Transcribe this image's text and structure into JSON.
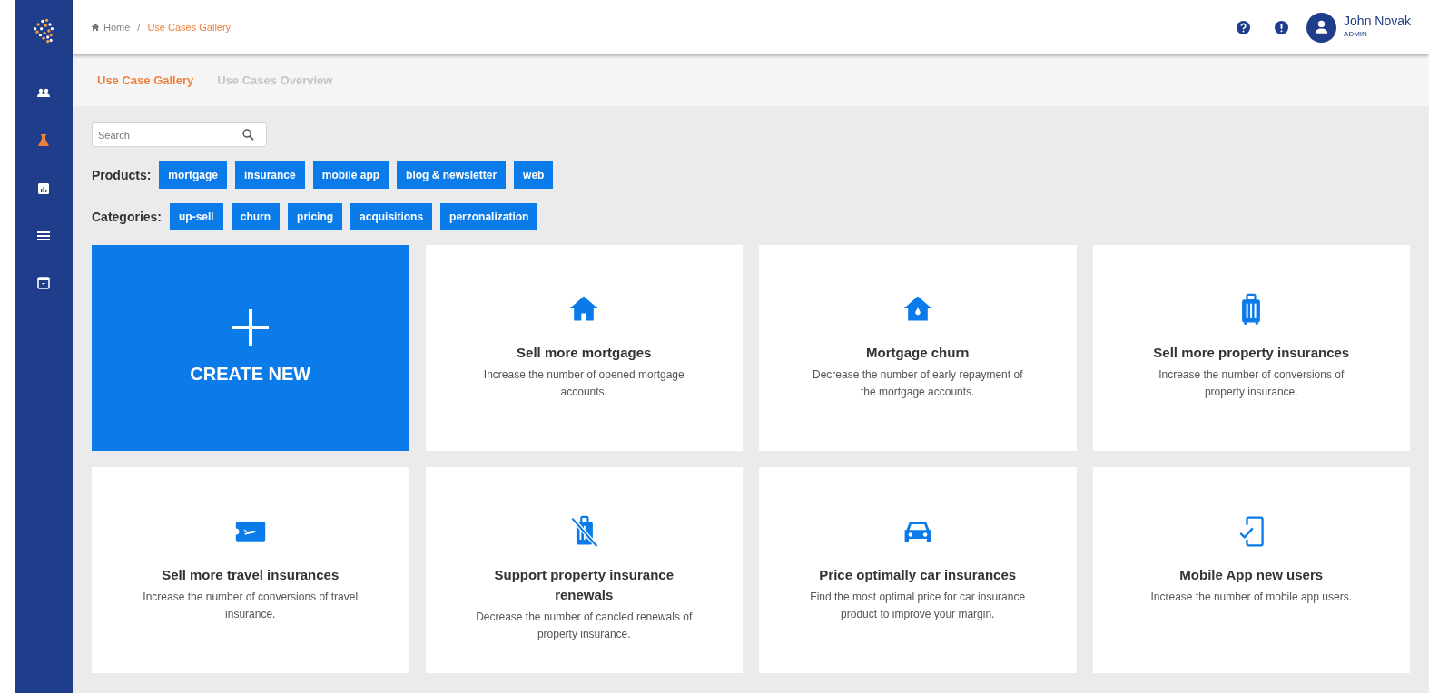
{
  "sidebar": {
    "items": [
      {
        "selected": false
      },
      {
        "selected": true
      },
      {
        "selected": false
      },
      {
        "selected": false
      },
      {
        "selected": false
      }
    ]
  },
  "breadcrumb": {
    "home": "Home",
    "separator": "/",
    "current": "Use Cases Gallery"
  },
  "user": {
    "name": "John Novak",
    "role": "ADMIN"
  },
  "tabs": [
    {
      "label": "Use Case Gallery",
      "selected": true
    },
    {
      "label": "Use Cases Overview",
      "selected": false
    }
  ],
  "search": {
    "placeholder": "Search"
  },
  "filters": [
    {
      "label": "Products:",
      "tags": [
        "mortgage",
        "insurance",
        "mobile app",
        "blog & newsletter",
        "web"
      ]
    },
    {
      "label": "Categories:",
      "tags": [
        "up-sell",
        "churn",
        "pricing",
        "acquisitions",
        "perzonalization"
      ]
    }
  ],
  "cards": [
    {
      "kind": "create",
      "title": "CREATE NEW"
    },
    {
      "kind": "use_case",
      "title": "Sell more mortgages",
      "description": "Increase the number of opened mortgage accounts."
    },
    {
      "kind": "use_case",
      "title": "Mortgage churn",
      "description": "Decrease the number of early repayment of the mortgage accounts."
    },
    {
      "kind": "use_case",
      "title": "Sell more property insurances",
      "description": "Increase the number of conversions of property insurance."
    },
    {
      "kind": "use_case",
      "title": "Sell more travel insurances",
      "description": "Increase the number of conversions of travel insurance."
    },
    {
      "kind": "use_case",
      "title": "Support property insurance renewals",
      "description": "Decrease the number of cancled renewals of property insurance."
    },
    {
      "kind": "use_case",
      "title": "Price optimally car insurances",
      "description": "Find the most optimal price for car insurance product to improve your margin."
    },
    {
      "kind": "use_case",
      "title": "Mobile App new users",
      "description": "Increase the number of mobile app users."
    }
  ]
}
